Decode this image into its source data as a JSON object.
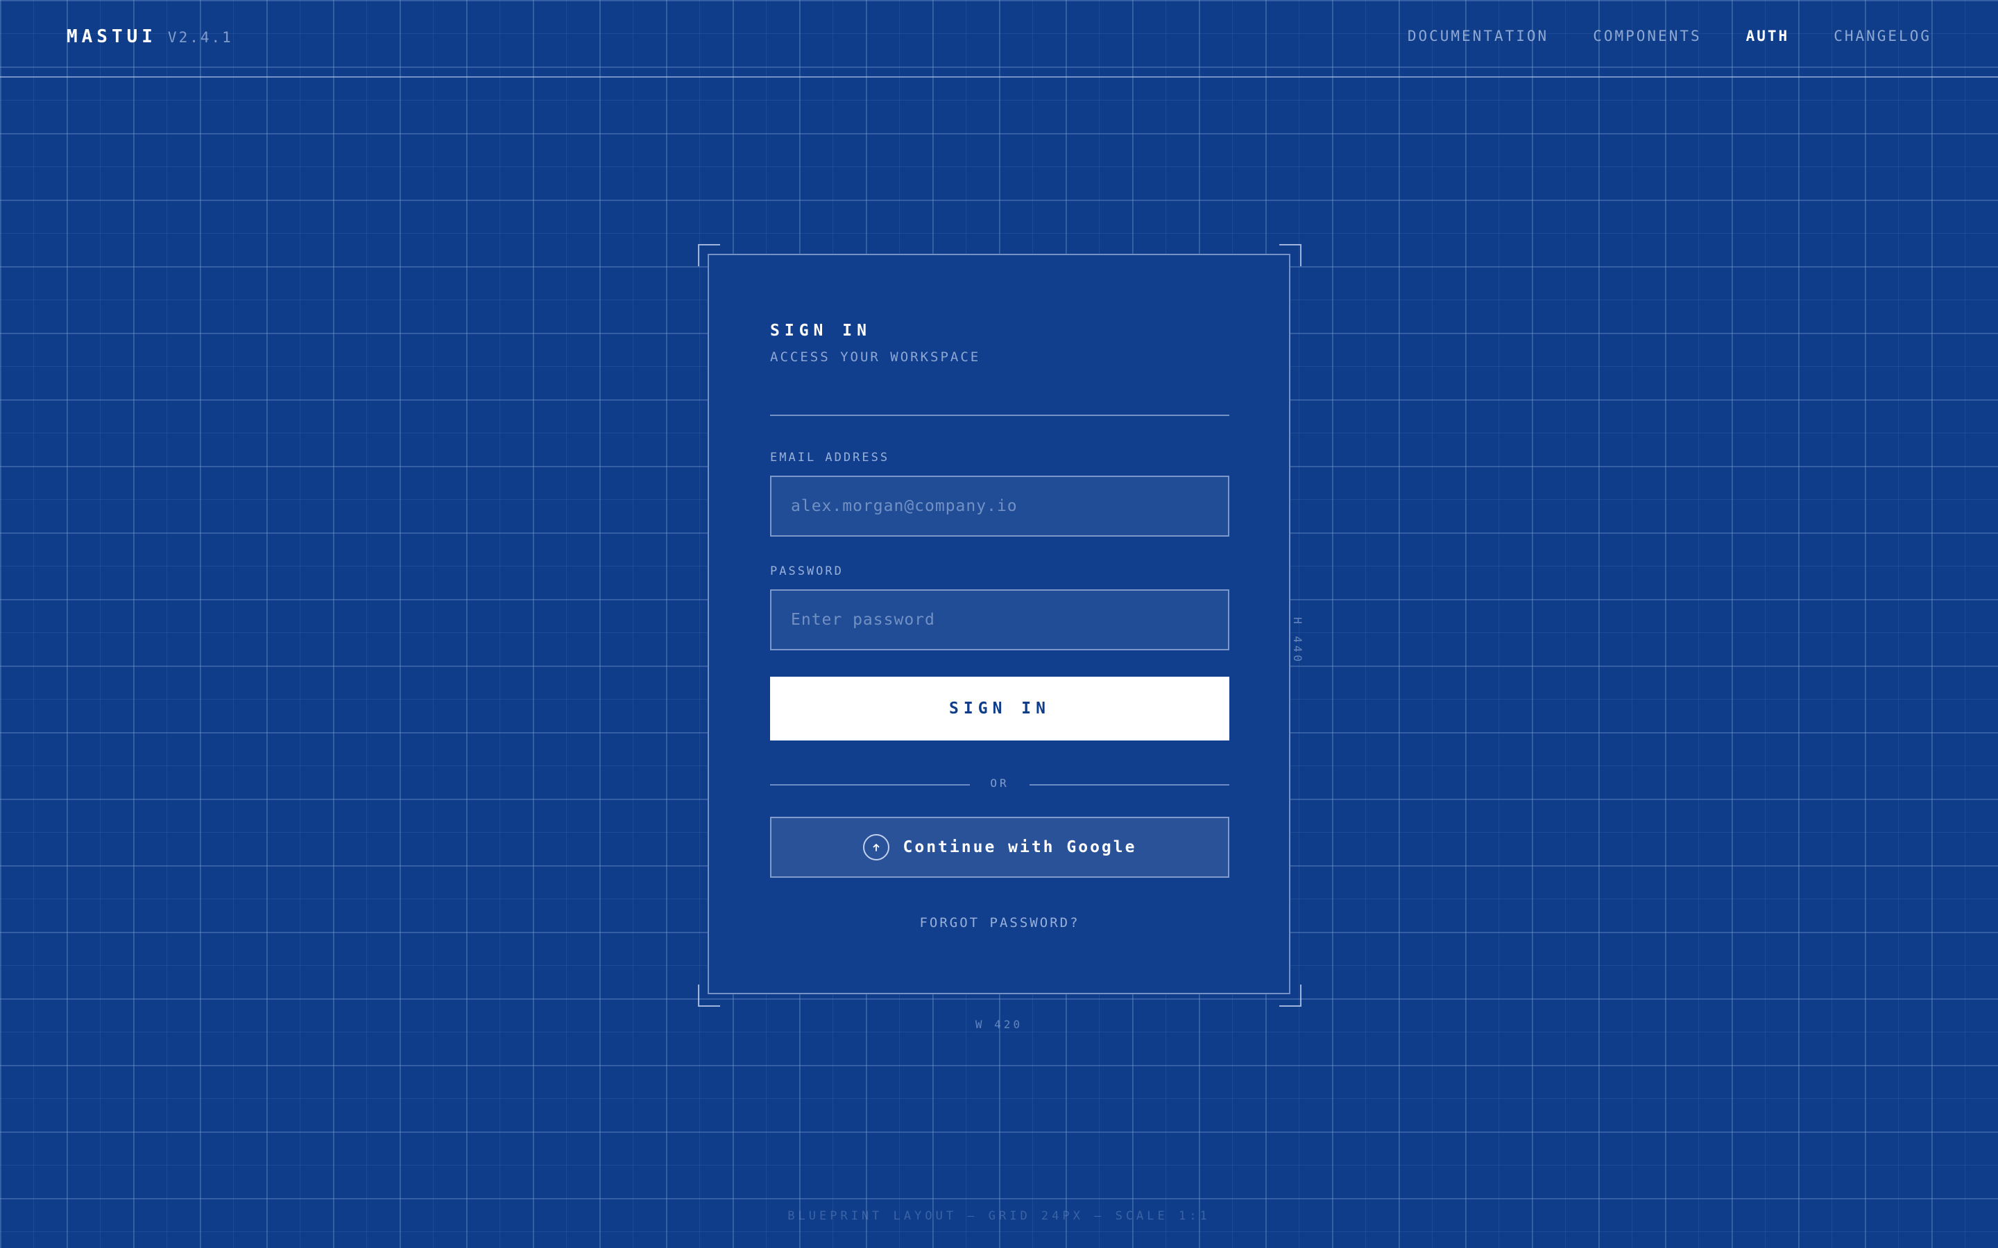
{
  "header": {
    "brand": "MASTUI",
    "version": "V2.4.1",
    "nav": [
      {
        "label": "DOCUMENTATION",
        "active": false
      },
      {
        "label": "COMPONENTS",
        "active": false
      },
      {
        "label": "AUTH",
        "active": true
      },
      {
        "label": "CHANGELOG",
        "active": false
      }
    ]
  },
  "card": {
    "title": "SIGN IN",
    "subtitle": "ACCESS YOUR WORKSPACE",
    "email": {
      "label": "EMAIL ADDRESS",
      "placeholder": "alex.morgan@company.io",
      "value": ""
    },
    "password": {
      "label": "PASSWORD",
      "placeholder": "Enter password",
      "value": ""
    },
    "signin_label": "SIGN IN",
    "divider_label": "OR",
    "google_label": "Continue with Google",
    "google_icon": "upload-circle-icon",
    "forgot_label": "FORGOT PASSWORD?"
  },
  "annotations": {
    "height": "H 440",
    "width": "W 420",
    "footer": "BLUEPRINT LAYOUT — GRID 24PX — SCALE 1:1"
  },
  "colors": {
    "background": "#0f3d8a",
    "card": "#113f8e",
    "primary_button": "#ffffff",
    "primary_button_text": "#0f3d8a"
  }
}
